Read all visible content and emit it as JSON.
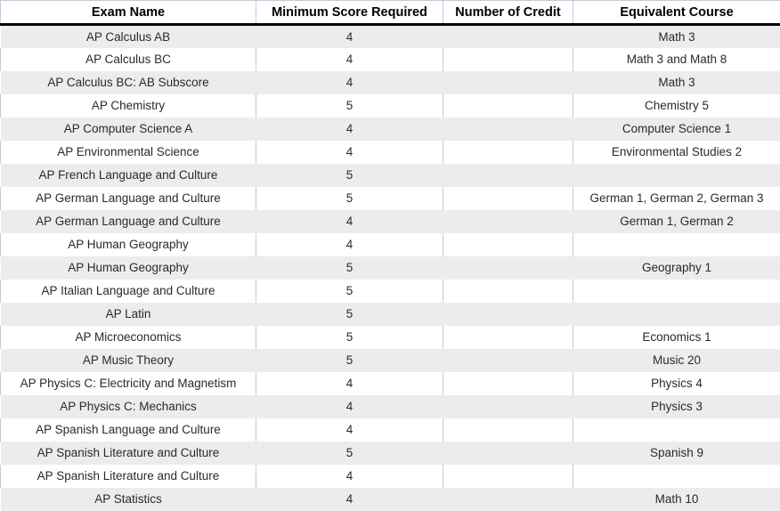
{
  "table": {
    "columns": [
      {
        "key": "exam",
        "label": "Exam Name"
      },
      {
        "key": "score",
        "label": "Minimum Score Required"
      },
      {
        "key": "credit",
        "label": "Number of Credit"
      },
      {
        "key": "equiv",
        "label": "Equivalent Course"
      }
    ],
    "rows": [
      {
        "exam": "AP Calculus AB",
        "score": "4",
        "credit": "",
        "equiv": "Math 3"
      },
      {
        "exam": "AP Calculus BC",
        "score": "4",
        "credit": "",
        "equiv": "Math 3 and Math 8"
      },
      {
        "exam": "AP Calculus BC: AB Subscore",
        "score": "4",
        "credit": "",
        "equiv": "Math 3"
      },
      {
        "exam": "AP Chemistry",
        "score": "5",
        "credit": "",
        "equiv": "Chemistry 5"
      },
      {
        "exam": "AP Computer Science A",
        "score": "4",
        "credit": "",
        "equiv": "Computer Science 1"
      },
      {
        "exam": "AP Environmental Science",
        "score": "4",
        "credit": "",
        "equiv": "Environmental Studies 2"
      },
      {
        "exam": "AP French Language and Culture",
        "score": "5",
        "credit": "",
        "equiv": ""
      },
      {
        "exam": "AP German Language and Culture",
        "score": "5",
        "credit": "",
        "equiv": "German 1, German 2, German 3"
      },
      {
        "exam": "AP German Language and Culture",
        "score": "4",
        "credit": "",
        "equiv": "German 1, German 2"
      },
      {
        "exam": "AP Human Geography",
        "score": "4",
        "credit": "",
        "equiv": ""
      },
      {
        "exam": "AP Human Geography",
        "score": "5",
        "credit": "",
        "equiv": "Geography 1"
      },
      {
        "exam": "AP Italian Language and Culture",
        "score": "5",
        "credit": "",
        "equiv": ""
      },
      {
        "exam": "AP Latin",
        "score": "5",
        "credit": "",
        "equiv": ""
      },
      {
        "exam": "AP Microeconomics",
        "score": "5",
        "credit": "",
        "equiv": "Economics 1"
      },
      {
        "exam": "AP Music Theory",
        "score": "5",
        "credit": "",
        "equiv": "Music 20"
      },
      {
        "exam": "AP Physics C: Electricity and Magnetism",
        "score": "4",
        "credit": "",
        "equiv": "Physics 4"
      },
      {
        "exam": "AP Physics C: Mechanics",
        "score": "4",
        "credit": "",
        "equiv": "Physics 3"
      },
      {
        "exam": "AP Spanish Language and Culture",
        "score": "4",
        "credit": "",
        "equiv": ""
      },
      {
        "exam": "AP Spanish Literature and Culture",
        "score": "5",
        "credit": "",
        "equiv": "Spanish 9"
      },
      {
        "exam": "AP Spanish Literature and Culture",
        "score": "4",
        "credit": "",
        "equiv": ""
      },
      {
        "exam": "AP Statistics",
        "score": "4",
        "credit": "",
        "equiv": "Math 10"
      }
    ]
  },
  "colors": {
    "shaded_row": "#ececec",
    "plain_row": "#ffffff",
    "grid_line": "#c5cad8",
    "header_rule": "#000000",
    "body_text": "#2a2a2a"
  }
}
